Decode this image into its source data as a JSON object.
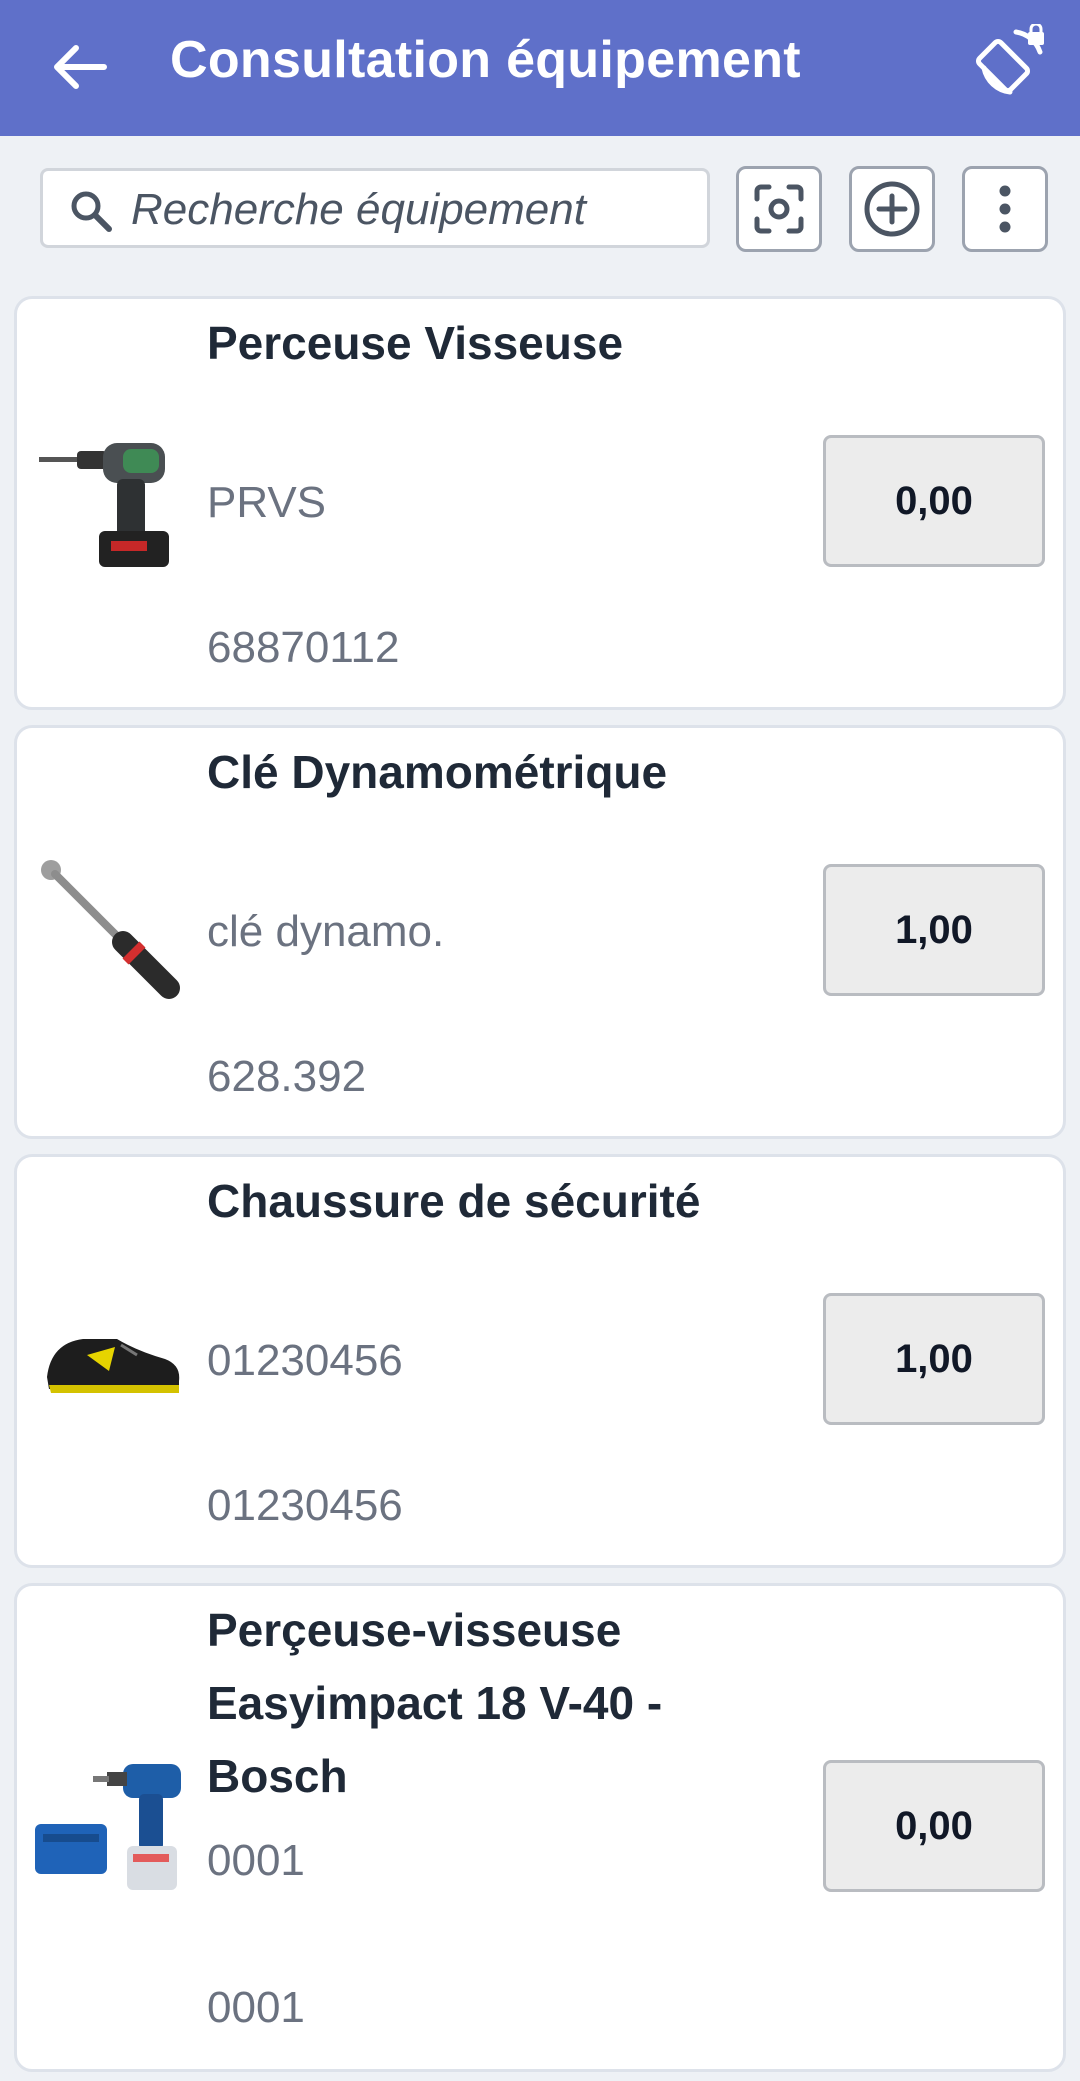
{
  "header": {
    "title": "Consultation équipement",
    "back_icon": "arrow-left-icon",
    "rotate_icon": "screen-rotation-lock-icon",
    "background": "#5f70c9"
  },
  "search": {
    "placeholder": "Recherche équipement",
    "value": ""
  },
  "toolbar": {
    "scan_icon": "scan-icon",
    "add_icon": "add-circle-icon",
    "more_icon": "more-vertical-icon"
  },
  "items": [
    {
      "name": "Perceuse Visseuse",
      "code": "PRVS",
      "ref": "68870112",
      "qty": "0,00",
      "image_icon": "drill-image"
    },
    {
      "name": "Clé Dynamométrique",
      "code": "clé dynamo.",
      "ref": "628.392",
      "qty": "1,00",
      "image_icon": "torque-wrench-image"
    },
    {
      "name": "Chaussure de sécurité",
      "code": "01230456",
      "ref": "01230456",
      "qty": "1,00",
      "image_icon": "safety-shoe-image"
    },
    {
      "name": "Perçeuse-visseuse Easyimpact 18 V-40 - Bosch",
      "code": "0001",
      "ref": "0001",
      "qty": "0,00",
      "image_icon": "bosch-drill-image"
    }
  ]
}
